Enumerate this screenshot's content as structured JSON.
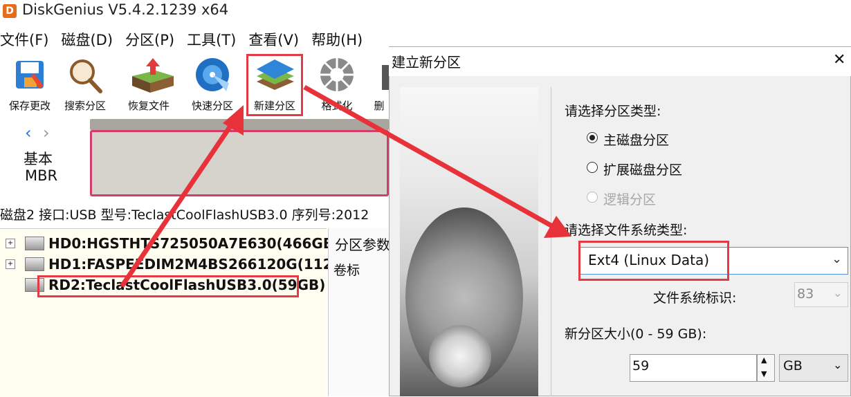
{
  "app": {
    "title": "DiskGenius V5.4.2.1239 x64",
    "icon_letter": "D"
  },
  "menu": [
    "文件(F)",
    "磁盘(D)",
    "分区(P)",
    "工具(T)",
    "查看(V)",
    "帮助(H)"
  ],
  "toolbar": {
    "items": [
      {
        "label": "保存更改",
        "icon": "save-changes-icon"
      },
      {
        "label": "搜索分区",
        "icon": "search-partition-icon"
      },
      {
        "label": "恢复文件",
        "icon": "recover-files-icon"
      },
      {
        "label": "快速分区",
        "icon": "quick-partition-icon"
      },
      {
        "label": "新建分区",
        "icon": "new-partition-icon"
      },
      {
        "label": "格式化",
        "icon": "format-icon"
      },
      {
        "label": "删",
        "icon": "delete-icon"
      }
    ]
  },
  "disk_map": {
    "basic": "基本",
    "mbr": "MBR"
  },
  "disk_info": "磁盘2 接口:USB  型号:TeclastCoolFlashUSB3.0  序列号:2012",
  "tree": {
    "items": [
      {
        "label": "HD0:HGSTHTS725050A7E630(466GB)"
      },
      {
        "label": "HD1:FASPEEDIM2M4BS266120G(112G"
      },
      {
        "label": "RD2:TeclastCoolFlashUSB3.0(59GB)"
      }
    ]
  },
  "params_panel": {
    "title": "分区参数",
    "volume_label": "卷标"
  },
  "dialog": {
    "title": "建立新分区",
    "close": "✕",
    "partition_type_label": "请选择分区类型:",
    "partition_types": [
      {
        "label": "主磁盘分区",
        "checked": true,
        "disabled": false
      },
      {
        "label": "扩展磁盘分区",
        "checked": false,
        "disabled": false
      },
      {
        "label": "逻辑分区",
        "checked": false,
        "disabled": true
      }
    ],
    "fs_type_label": "请选择文件系统类型:",
    "fs_type_value": "Ext4 (Linux Data)",
    "fs_id_label": "文件系统标识:",
    "fs_id_value": "83",
    "size_label": "新分区大小(0 - 59 GB):",
    "size_value": "59",
    "size_unit": "GB"
  },
  "colors": {
    "highlight": "#e23b45",
    "arrow": "#e8323a",
    "accent": "#2b73d6"
  }
}
